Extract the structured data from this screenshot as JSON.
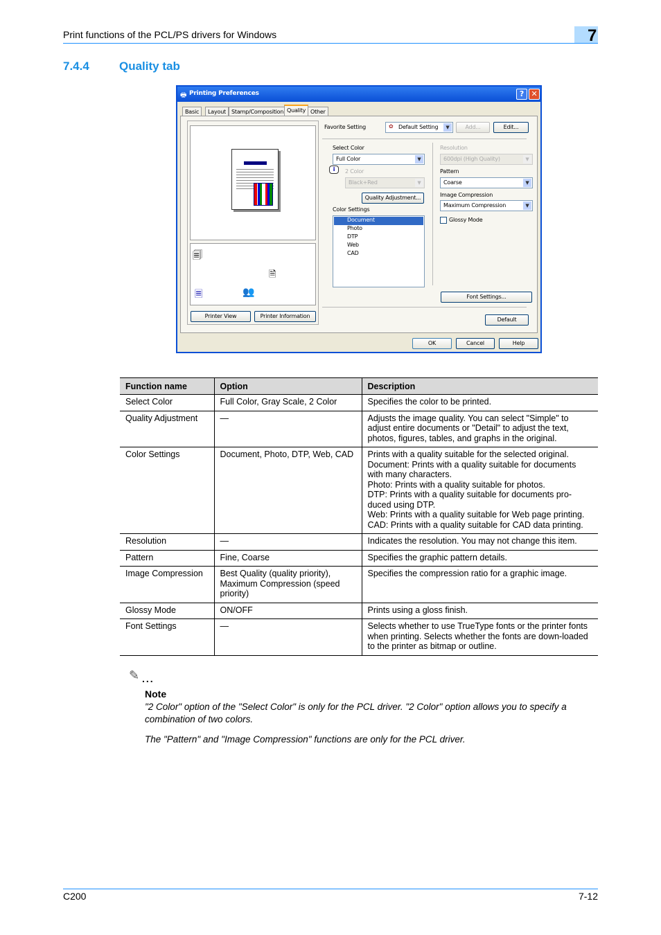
{
  "header": {
    "title": "Print functions of the PCL/PS drivers for Windows",
    "chapter": "7"
  },
  "section": {
    "number": "7.4.4",
    "title": "Quality tab"
  },
  "dialog": {
    "title": "Printing Preferences",
    "tabs": [
      "Basic",
      "Layout",
      "Stamp/Composition",
      "Quality",
      "Other"
    ],
    "active_tab": "Quality",
    "favorite_label": "Favorite Setting",
    "favorite_value": "Default Setting",
    "add": "Add...",
    "edit": "Edit...",
    "select_color_label": "Select Color",
    "select_color_value": "Full Color",
    "two_color_label": "2 Color",
    "two_color_value": "Black+Red",
    "quality_adjustment": "Quality Adjustment...",
    "color_settings_label": "Color Settings",
    "color_settings": [
      "Document",
      "Photo",
      "DTP",
      "Web",
      "CAD"
    ],
    "color_settings_selected": "Document",
    "resolution_label": "Resolution",
    "resolution_value": "600dpi (High Quality)",
    "pattern_label": "Pattern",
    "pattern_value": "Coarse",
    "image_compression_label": "Image Compression",
    "image_compression_value": "Maximum Compression",
    "glossy_label": "Glossy Mode",
    "glossy_checked": false,
    "font_settings": "Font Settings...",
    "default": "Default",
    "printer_view": "Printer View",
    "printer_information": "Printer Information",
    "ok": "OK",
    "cancel": "Cancel",
    "help": "Help"
  },
  "table": {
    "headers": [
      "Function name",
      "Option",
      "Description"
    ],
    "rows": [
      [
        "Select Color",
        "Full Color, Gray Scale, 2 Color",
        "Specifies the color to be printed."
      ],
      [
        "Quality Adjustment",
        "—",
        "Adjusts the image quality. You can select \"Simple\" to adjust entire documents or \"Detail\" to adjust the text, photos, figures, tables, and graphs in the original."
      ],
      [
        "Color Settings",
        "Document, Photo, DTP, Web, CAD",
        "Prints with a quality suitable for the selected original.\nDocument: Prints with a quality suitable for documents with many characters.\nPhoto: Prints with a quality suitable for photos.\nDTP: Prints with a quality suitable for documents pro-duced using DTP.\nWeb: Prints with a quality suitable for Web page printing.\nCAD: Prints with a quality suitable for CAD data printing."
      ],
      [
        "Resolution",
        "—",
        "Indicates the resolution. You may not change this item."
      ],
      [
        "Pattern",
        "Fine, Coarse",
        "Specifies the graphic pattern details."
      ],
      [
        "Image Compression",
        "Best Quality (quality priority), Maximum Compression (speed priority)",
        "Specifies the compression ratio for a graphic image."
      ],
      [
        "Glossy Mode",
        "ON/OFF",
        "Prints using a gloss finish."
      ],
      [
        "Font Settings",
        "—",
        "Selects whether to use TrueType fonts or the printer fonts when printing. Selects whether the fonts are down-loaded to the printer as bitmap or outline."
      ]
    ]
  },
  "note": {
    "title": "Note",
    "icon": "pencil-icon",
    "paragraphs": [
      "\"2 Color\" option of the \"Select Color\" is only for the PCL driver. \"2 Color\" option allows you to specify a combination of two colors.",
      "The \"Pattern\" and \"Image Compression\" functions are only for the PCL driver."
    ]
  },
  "footer": {
    "model": "C200",
    "page": "7-12"
  },
  "colors": {
    "accent": "#1a8fe3",
    "titlebar": "#0a4fd6",
    "selection": "#316ac5"
  }
}
